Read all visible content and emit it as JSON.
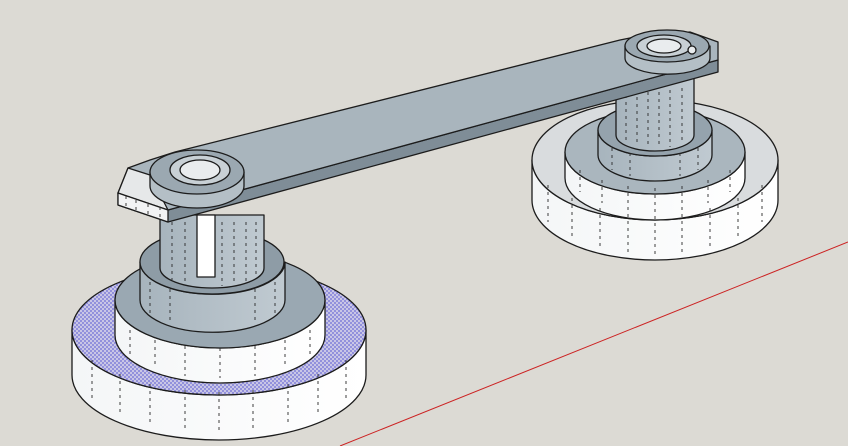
{
  "viewport": {
    "background_color": "#dcdad4",
    "axis_red_color": "#cc2222"
  },
  "model": {
    "face_front_color": "#ffffff",
    "face_back_color": "#9aa8b2",
    "selection_overlay_color": "#6b6bd6",
    "edge_color": "#1c1c1c",
    "parts": [
      {
        "name": "left-pulley",
        "selected": true
      },
      {
        "name": "right-pulley",
        "selected": false
      },
      {
        "name": "connecting-arm",
        "selected": false
      }
    ]
  }
}
